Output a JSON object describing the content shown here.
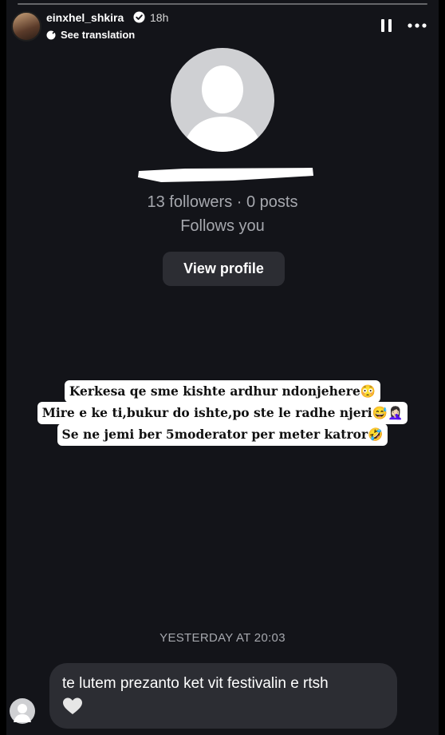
{
  "story": {
    "username": "einxhel_shkira",
    "time_ago": "18h",
    "see_translation": "See translation"
  },
  "icons": {
    "verified": "verified-badge-icon",
    "translate": "translate-icon",
    "pause": "pause-icon",
    "more": "more-options-icon",
    "heart": "heart-icon"
  },
  "profile_card": {
    "stats": "13 followers · 0 posts",
    "follows_you": "Follows you",
    "view_profile_label": "View profile"
  },
  "caption": {
    "lines": [
      "Kerkesa qe sme kishte ardhur ndonjehere😳",
      "Mire e ke ti,bukur do ishte,po ste le radhe njeri😅🤦🏻‍♀️",
      "Se ne jemi ber 5moderator per meter katror🤣"
    ]
  },
  "message": {
    "timestamp": "YESTERDAY AT 20:03",
    "text": "te lutem prezanto ket vit festivalin e rtsh",
    "reaction": "🤍"
  },
  "colors": {
    "background": "#131419",
    "bubble": "#2c2d33",
    "muted_text": "#a6a8ae"
  }
}
